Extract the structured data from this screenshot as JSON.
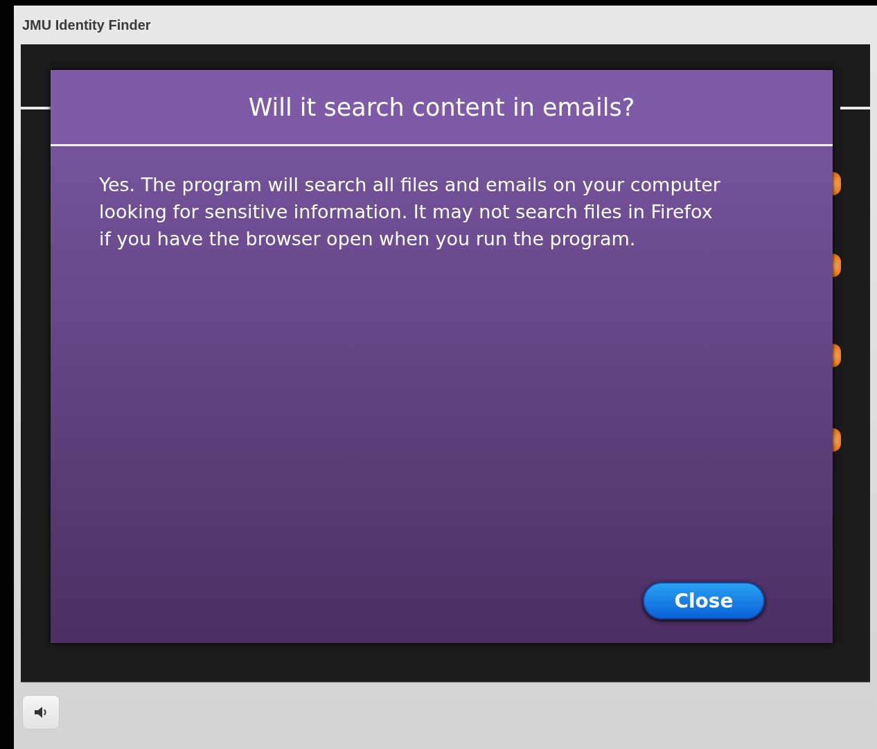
{
  "window": {
    "title": "JMU Identity Finder"
  },
  "dialog": {
    "title": "Will it search content in emails?",
    "body": "Yes. The program will search all files and emails on your computer looking for sensitive information. It may not search files in Firefox if you have the browser open when you run the program.",
    "button": "Close"
  }
}
